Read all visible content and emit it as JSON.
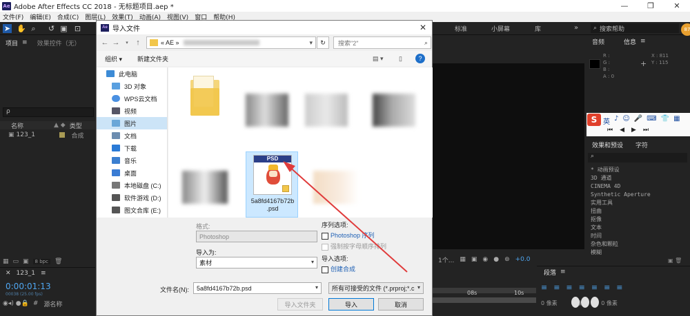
{
  "app": {
    "title": "Adobe After Effects CC 2018 - 无标题项目.aep *",
    "logo": "Ae",
    "window_controls": [
      "—",
      "❐",
      "✕"
    ],
    "menu": [
      "文件(F)",
      "编辑(E)",
      "合成(C)",
      "图层(L)",
      "效果(T)",
      "动画(A)",
      "视图(V)",
      "窗口",
      "帮助(H)"
    ],
    "workspace_tabs": [
      "标准",
      "小屏幕",
      "库"
    ],
    "search_help": "搜索帮助",
    "user_badge": "87"
  },
  "project_panel": {
    "tab_project": "项目",
    "tab_effects_controls": "效果控件（无）",
    "search_placeholder": "ρ",
    "col_name": "名称",
    "col_type": "类型",
    "item_name": "123_1",
    "item_type": "合成",
    "bpc": "8 bpc"
  },
  "timeline": {
    "comp_tab": "123_1",
    "timecode": "0:00:01:13",
    "frames": "00038 (25.00 fps)",
    "col_source": "源名称",
    "ruler_mark": "08s",
    "ruler_mark2": "10s",
    "viewer_zoom": "1个...",
    "offset": "+0.0"
  },
  "right_panel": {
    "tab_audio": "音频",
    "tab_info": "信息",
    "info_labels": [
      "R :",
      "G :",
      "B :",
      "A : 0"
    ],
    "x_label": "X : 811",
    "y_label": "Y : 115",
    "effects_tab": "效果和预设",
    "char_tab": "字符",
    "effects_list": [
      "* 动画预设",
      "3D 通道",
      "CINEMA 4D",
      "Synthetic Aperture",
      "实用工具",
      "扭曲",
      "抠像",
      "文本",
      "时间",
      "杂色和颗粒",
      "模糊"
    ],
    "para_tab": "段落",
    "para_vals": [
      "0 像素",
      "0 像素",
      "0 像素",
      "0 像素",
      "0 像素"
    ],
    "ime_label": "英"
  },
  "dialog": {
    "title": "导入文件",
    "close": "✕",
    "address": "« AE »",
    "search_placeholder": "搜索\"2\"",
    "organize": "组织 ▾",
    "new_folder": "新建文件夹",
    "tree": [
      {
        "label": "此电脑",
        "icon": "pc-icon",
        "color": "#3d8bd6"
      },
      {
        "label": "3D 对象",
        "icon": "3d-objects-icon",
        "color": "#5aa0e0"
      },
      {
        "label": "WPS云文档",
        "icon": "cloud-icon",
        "color": "#4a90e2"
      },
      {
        "label": "视频",
        "icon": "video-icon",
        "color": "#556"
      },
      {
        "label": "图片",
        "icon": "pictures-icon",
        "color": "#6aa7d8",
        "selected": true
      },
      {
        "label": "文档",
        "icon": "documents-icon",
        "color": "#6c8db0"
      },
      {
        "label": "下载",
        "icon": "downloads-icon",
        "color": "#2a7ad6"
      },
      {
        "label": "音乐",
        "icon": "music-icon",
        "color": "#3b7fd0"
      },
      {
        "label": "桌面",
        "icon": "desktop-icon",
        "color": "#3a7cd4"
      },
      {
        "label": "本地磁盘 (C:)",
        "icon": "disk-icon",
        "color": "#777"
      },
      {
        "label": "软件游戏 (D:)",
        "icon": "disk-icon",
        "color": "#555"
      },
      {
        "label": "图文合库 (E:)",
        "icon": "disk-icon",
        "color": "#555"
      }
    ],
    "selected_file": {
      "badge": "PSD",
      "name_line1": "5a8fd4167b72b",
      "name_line2": ".psd"
    },
    "format_label": "格式:",
    "format_value": "Photoshop",
    "import_as_label": "导入为:",
    "import_as_value": "素材",
    "sequence_label": "序列选项:",
    "sequence_photoshop": "Photoshop 序列",
    "force_alpha": "强制按字母顺序排列",
    "import_options_label": "导入选项:",
    "create_comp": "创建合成",
    "filename_label": "文件名(N):",
    "filename_value": "5a8fd4167b72b.psd",
    "filetype_value": "所有可接受的文件 (*.prproj;*.c",
    "btn_import_folder": "导入文件夹",
    "btn_import": "导入",
    "btn_cancel": "取消"
  },
  "colors": {
    "accent_blue": "#4fa6f0",
    "arrow_red": "#e03b3b",
    "dialog_bg": "#f0f0f0"
  }
}
